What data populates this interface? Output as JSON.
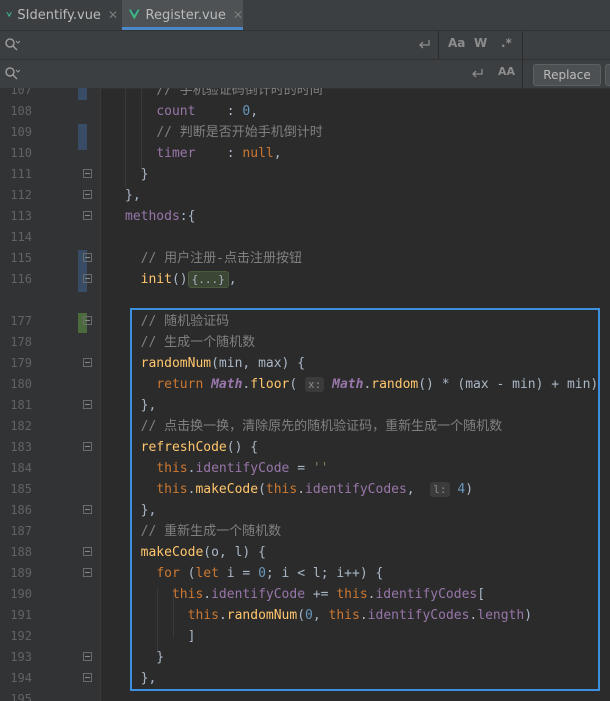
{
  "tabs": [
    {
      "label": "SIdentify.vue",
      "active": false
    },
    {
      "label": "Register.vue",
      "active": true
    }
  ],
  "find": {
    "placeholder": "",
    "match_case_label": "Aa",
    "words_label": "W",
    "regex_label": ".*"
  },
  "replace": {
    "placeholder": "",
    "preserve_case_label": "AA",
    "button_label": "Replace"
  },
  "colors": {
    "background": "#2b2b2b",
    "accent": "#4a88c7",
    "selection_box": "#3d8fe0"
  },
  "lines": [
    {
      "num": "107",
      "html": "    <span class='cm'>// 手机验证码倒计时的时间</span>"
    },
    {
      "num": "108",
      "html": "    <span class='pr'>count</span>    : <span class='num'>0</span>,"
    },
    {
      "num": "109",
      "html": "    <span class='cm'>// 判断是否开始手机倒计时</span>"
    },
    {
      "num": "110",
      "html": "    <span class='pr'>timer</span>    : <span class='kw'>null</span>,"
    },
    {
      "num": "111",
      "html": "  }"
    },
    {
      "num": "112",
      "html": "},"
    },
    {
      "num": "113",
      "html": "<span class='pr'>methods</span>:{"
    },
    {
      "num": "114",
      "html": ""
    },
    {
      "num": "115",
      "html": "  <span class='cm'>// 用户注册-点击注册按钮</span>"
    },
    {
      "num": "116",
      "html": "  <span class='fn'>init</span>()<span class='hint foldbox'>{...}</span>,"
    },
    {
      "num": "",
      "html": ""
    },
    {
      "num": "177",
      "html": "  <span class='cm'>// 随机验证码</span>"
    },
    {
      "num": "178",
      "html": "  <span class='cm'>// 生成一个随机数</span>"
    },
    {
      "num": "179",
      "html": "  <span class='fn'>randomNum</span>(min, max) {"
    },
    {
      "num": "180",
      "html": "    <span class='kw'>return</span> <span class='it'>Math</span>.<span class='fn'>floor</span>( <span class='hint'>x:</span> <span class='it'>Math</span>.<span class='fn'>random</span>() * (max - min) + min)"
    },
    {
      "num": "181",
      "html": "  },"
    },
    {
      "num": "182",
      "html": "  <span class='cm'>// 点击换一换，清除原先的随机验证码，重新生成一个随机数</span>"
    },
    {
      "num": "183",
      "html": "  <span class='fn'>refreshCode</span>() {"
    },
    {
      "num": "184",
      "html": "    <span class='kw'>this</span>.<span class='pr'>identifyCode</span> = <span class='str'>''</span>"
    },
    {
      "num": "185",
      "html": "    <span class='kw'>this</span>.<span class='fn'>makeCode</span>(<span class='kw'>this</span>.<span class='pr'>identifyCodes</span>,  <span class='hint'>l:</span> <span class='num'>4</span>)"
    },
    {
      "num": "186",
      "html": "  },"
    },
    {
      "num": "187",
      "html": "  <span class='cm'>// 重新生成一个随机数</span>"
    },
    {
      "num": "188",
      "html": "  <span class='fn'>makeCode</span>(o, l) {"
    },
    {
      "num": "189",
      "html": "    <span class='kw'>for</span> (<span class='kw'>let</span> i = <span class='num'>0</span>; i &lt; l; i++) {"
    },
    {
      "num": "190",
      "html": "      <span class='kw'>this</span>.<span class='pr'>identifyCode</span> += <span class='kw'>this</span>.<span class='pr'>identifyCodes</span>["
    },
    {
      "num": "191",
      "html": "        <span class='kw'>this</span>.<span class='fn'>randomNum</span>(<span class='num'>0</span>, <span class='kw'>this</span>.<span class='pr'>identifyCodes</span>.<span class='pr'>length</span>)"
    },
    {
      "num": "192",
      "html": "        ]"
    },
    {
      "num": "193",
      "html": "    }"
    },
    {
      "num": "194",
      "html": "  },"
    },
    {
      "num": "195",
      "html": ""
    }
  ]
}
